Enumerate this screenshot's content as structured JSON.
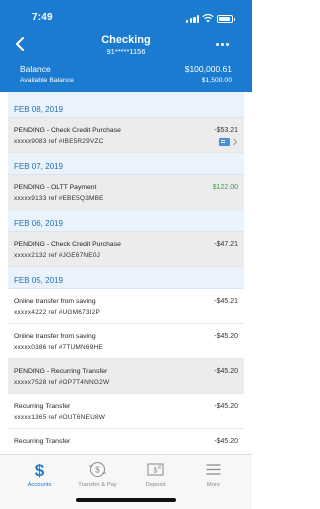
{
  "status_bar": {
    "time": "7:49"
  },
  "nav": {
    "title": "Checking",
    "account_number": "91*****1156"
  },
  "balance": {
    "label": "Balance",
    "value": "$100,000.61",
    "available_label": "Available Balance",
    "available_value": "$1,500.00"
  },
  "groups": [
    {
      "date": "FEB 08, 2019",
      "transactions": [
        {
          "title": "PENDING - Check Credit Purchase",
          "ref": "xxxxx9083 ref #IBE5R29VZC",
          "amount": "-$53.21",
          "pending": true,
          "has_check_icon": true
        }
      ]
    },
    {
      "date": "FEB 07, 2019",
      "transactions": [
        {
          "title": "PENDING - OLTT Payment",
          "ref": "xxxxx9133 ref #EBE5Q3MBE",
          "amount": "$122.00",
          "pending": true,
          "credit": true
        }
      ]
    },
    {
      "date": "FEB 06, 2019",
      "transactions": [
        {
          "title": "PENDING - Check Credit Purchase",
          "ref": "xxxxx2132 ref #JGE67NE0J",
          "amount": "-$47.21",
          "pending": true
        }
      ]
    },
    {
      "date": "FEB 05, 2019",
      "transactions": [
        {
          "title": "Online transfer from saving",
          "ref": "xxxxx4222 ref #UGM673I2P",
          "amount": "-$45.21",
          "pending": false
        },
        {
          "title": "Online transfer from saving",
          "ref": "xxxxx0386 ref #7TUMN69HE",
          "amount": "-$45.20",
          "pending": false
        },
        {
          "title": "PENDING - Recurring Transfer",
          "ref": "xxxxx7528 ref #OP7T4NNG2W",
          "amount": "-$45.20",
          "pending": true
        },
        {
          "title": "Recurring Transfer",
          "ref": "xxxxx1365 ref #OUT6NEU8W",
          "amount": "-$45.20",
          "pending": false
        },
        {
          "title": "Recurring Transfer",
          "ref": "",
          "amount": "-$45.20",
          "pending": false
        }
      ]
    }
  ],
  "tabs": [
    {
      "label": "Accounts",
      "icon": "dollar-icon",
      "active": true
    },
    {
      "label": "Transfer & Pay",
      "icon": "transfer-pay-icon",
      "active": false
    },
    {
      "label": "Deposit",
      "icon": "deposit-check-icon",
      "active": false
    },
    {
      "label": "More",
      "icon": "menu-lines-icon",
      "active": false
    }
  ],
  "colors": {
    "brand_blue": "#1a7bd1",
    "credit_green": "#3e9b4a",
    "pending_gray": "#ececec",
    "date_header_bg": "#eaf3fb"
  }
}
